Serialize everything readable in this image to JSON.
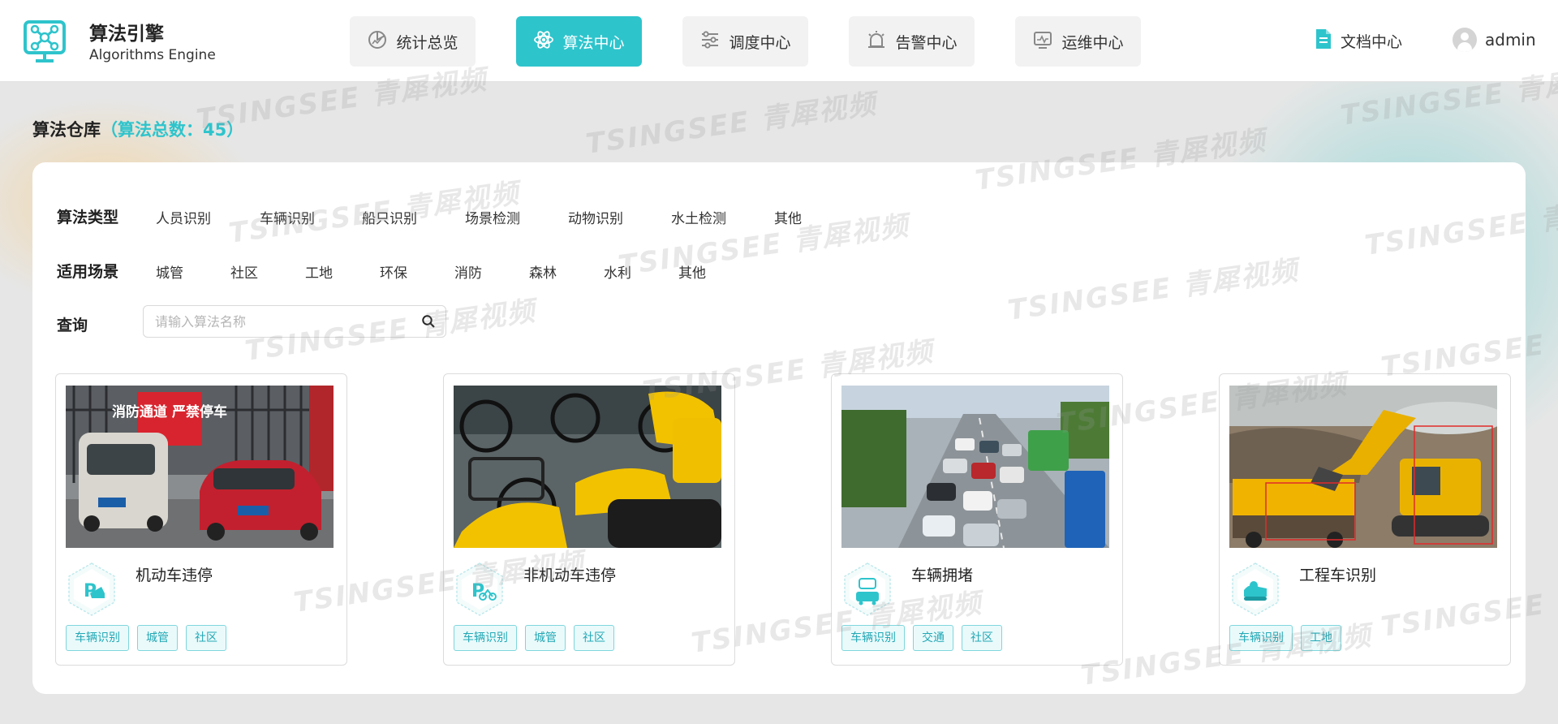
{
  "app": {
    "title": "算法引擎",
    "subtitle": "Algorithms Engine",
    "accent": "#2ec4cc"
  },
  "nav": [
    {
      "label": "统计总览",
      "icon": "stats-icon",
      "active": false
    },
    {
      "label": "算法中心",
      "icon": "atom-icon",
      "active": true
    },
    {
      "label": "调度中心",
      "icon": "sliders-icon",
      "active": false
    },
    {
      "label": "告警中心",
      "icon": "alarm-icon",
      "active": false
    },
    {
      "label": "运维中心",
      "icon": "monitor-icon",
      "active": false
    }
  ],
  "header_right": {
    "docs_label": "文档中心",
    "user_name": "admin"
  },
  "repository": {
    "title": "算法仓库",
    "count_text": "（算法总数：45）"
  },
  "filters": {
    "type_label": "算法类型",
    "types": [
      "人员识别",
      "车辆识别",
      "船只识别",
      "场景检测",
      "动物识别",
      "水土检测",
      "其他"
    ],
    "scene_label": "适用场景",
    "scenes": [
      "城管",
      "社区",
      "工地",
      "环保",
      "消防",
      "森林",
      "水利",
      "其他"
    ],
    "query_label": "查询",
    "search_placeholder": "请输入算法名称",
    "search_value": ""
  },
  "cards": [
    {
      "title": "机动车违停",
      "icon": "car-parking-icon",
      "tags": [
        "车辆识别",
        "城管",
        "社区"
      ],
      "image_text": "消防通道 严禁停车"
    },
    {
      "title": "非机动车违停",
      "icon": "bike-parking-icon",
      "tags": [
        "车辆识别",
        "城管",
        "社区"
      ]
    },
    {
      "title": "车辆拥堵",
      "icon": "traffic-jam-icon",
      "tags": [
        "车辆识别",
        "交通",
        "社区"
      ]
    },
    {
      "title": "工程车识别",
      "icon": "excavator-icon",
      "tags": [
        "车辆识别",
        "工地"
      ]
    }
  ],
  "watermark": "TSINGSEE 青犀视频"
}
